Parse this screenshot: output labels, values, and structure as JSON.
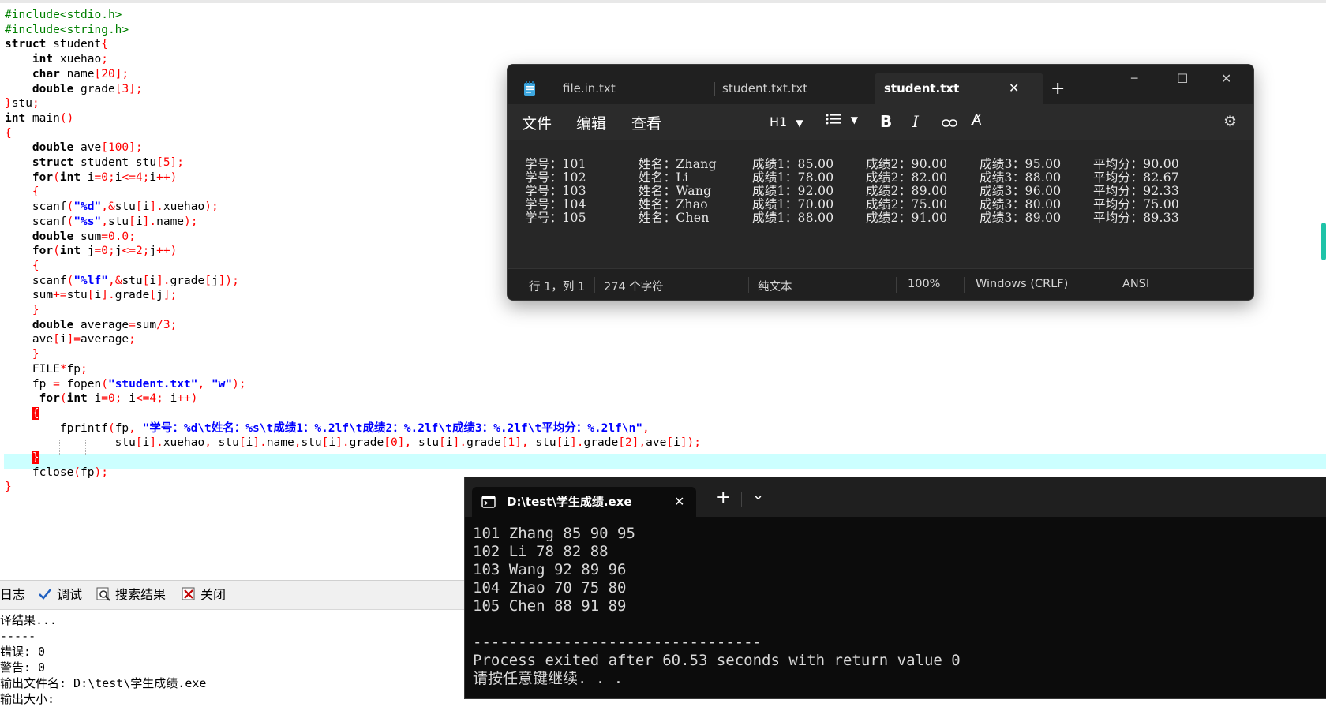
{
  "editor": {
    "code": [
      [
        [
          "pp",
          "#include<stdio.h>"
        ]
      ],
      [
        [
          "pp",
          "#include<string.h>"
        ]
      ],
      [
        [
          "kw",
          "struct"
        ],
        [
          "t",
          " student"
        ],
        [
          "op",
          "{"
        ]
      ],
      [
        [
          "t",
          "    "
        ],
        [
          "kw",
          "int"
        ],
        [
          "t",
          " xuehao"
        ],
        [
          "op",
          ";"
        ]
      ],
      [
        [
          "t",
          "    "
        ],
        [
          "kw",
          "char"
        ],
        [
          "t",
          " name"
        ],
        [
          "op",
          "["
        ],
        [
          "nm",
          "20"
        ],
        [
          "op",
          "];"
        ]
      ],
      [
        [
          "t",
          "    "
        ],
        [
          "kw",
          "double"
        ],
        [
          "t",
          " grade"
        ],
        [
          "op",
          "["
        ],
        [
          "nm",
          "3"
        ],
        [
          "op",
          "];"
        ]
      ],
      [
        [
          "op",
          "}"
        ],
        [
          "t",
          "stu"
        ],
        [
          "op",
          ";"
        ]
      ],
      [
        [
          "kw",
          "int"
        ],
        [
          "t",
          " main"
        ],
        [
          "op",
          "()"
        ]
      ],
      [
        [
          "op",
          "{"
        ]
      ],
      [
        [
          "t",
          "    "
        ],
        [
          "kw",
          "double"
        ],
        [
          "t",
          " ave"
        ],
        [
          "op",
          "["
        ],
        [
          "nm",
          "100"
        ],
        [
          "op",
          "];"
        ]
      ],
      [
        [
          "t",
          "    "
        ],
        [
          "kw",
          "struct"
        ],
        [
          "t",
          " student stu"
        ],
        [
          "op",
          "["
        ],
        [
          "nm",
          "5"
        ],
        [
          "op",
          "];"
        ]
      ],
      [
        [
          "t",
          "    "
        ],
        [
          "kw",
          "for"
        ],
        [
          "op",
          "("
        ],
        [
          "kw",
          "int"
        ],
        [
          "t",
          " i"
        ],
        [
          "op",
          "="
        ],
        [
          "nm",
          "0"
        ],
        [
          "op",
          ";"
        ],
        [
          "t",
          "i"
        ],
        [
          "op",
          "<="
        ],
        [
          "nm",
          "4"
        ],
        [
          "op",
          ";"
        ],
        [
          "t",
          "i"
        ],
        [
          "op",
          "++)"
        ]
      ],
      [
        [
          "t",
          "    "
        ],
        [
          "op",
          "{"
        ]
      ],
      [
        [
          "t",
          "    scanf"
        ],
        [
          "op",
          "("
        ],
        [
          "stb",
          "\"%d\""
        ],
        [
          "op",
          ",&"
        ],
        [
          "t",
          "stu"
        ],
        [
          "op",
          "["
        ],
        [
          "t",
          "i"
        ],
        [
          "op",
          "]."
        ],
        [
          "t",
          "xuehao"
        ],
        [
          "op",
          ");"
        ]
      ],
      [
        [
          "t",
          "    scanf"
        ],
        [
          "op",
          "("
        ],
        [
          "stb",
          "\"%s\""
        ],
        [
          "op",
          ","
        ],
        [
          "t",
          "stu"
        ],
        [
          "op",
          "["
        ],
        [
          "t",
          "i"
        ],
        [
          "op",
          "]."
        ],
        [
          "t",
          "name"
        ],
        [
          "op",
          ");"
        ]
      ],
      [
        [
          "t",
          "    "
        ],
        [
          "kw",
          "double"
        ],
        [
          "t",
          " sum"
        ],
        [
          "op",
          "="
        ],
        [
          "nm",
          "0.0"
        ],
        [
          "op",
          ";"
        ]
      ],
      [
        [
          "t",
          "    "
        ],
        [
          "kw",
          "for"
        ],
        [
          "op",
          "("
        ],
        [
          "kw",
          "int"
        ],
        [
          "t",
          " j"
        ],
        [
          "op",
          "="
        ],
        [
          "nm",
          "0"
        ],
        [
          "op",
          ";"
        ],
        [
          "t",
          "j"
        ],
        [
          "op",
          "<="
        ],
        [
          "nm",
          "2"
        ],
        [
          "op",
          ";"
        ],
        [
          "t",
          "j"
        ],
        [
          "op",
          "++)"
        ]
      ],
      [
        [
          "t",
          "    "
        ],
        [
          "op",
          "{"
        ]
      ],
      [
        [
          "t",
          "    scanf"
        ],
        [
          "op",
          "("
        ],
        [
          "stb",
          "\"%lf\""
        ],
        [
          "op",
          ",&"
        ],
        [
          "t",
          "stu"
        ],
        [
          "op",
          "["
        ],
        [
          "t",
          "i"
        ],
        [
          "op",
          "]."
        ],
        [
          "t",
          "grade"
        ],
        [
          "op",
          "["
        ],
        [
          "t",
          "j"
        ],
        [
          "op",
          "]);"
        ]
      ],
      [
        [
          "t",
          "    sum"
        ],
        [
          "op",
          "+="
        ],
        [
          "t",
          "stu"
        ],
        [
          "op",
          "["
        ],
        [
          "t",
          "i"
        ],
        [
          "op",
          "]."
        ],
        [
          "t",
          "grade"
        ],
        [
          "op",
          "["
        ],
        [
          "t",
          "j"
        ],
        [
          "op",
          "];"
        ]
      ],
      [
        [
          "t",
          "    "
        ],
        [
          "op",
          "}"
        ]
      ],
      [
        [
          "t",
          "    "
        ],
        [
          "kw",
          "double"
        ],
        [
          "t",
          " average"
        ],
        [
          "op",
          "="
        ],
        [
          "t",
          "sum"
        ],
        [
          "op",
          "/"
        ],
        [
          "nm",
          "3"
        ],
        [
          "op",
          ";"
        ]
      ],
      [
        [
          "t",
          "    ave"
        ],
        [
          "op",
          "["
        ],
        [
          "t",
          "i"
        ],
        [
          "op",
          "]="
        ],
        [
          "t",
          "average"
        ],
        [
          "op",
          ";"
        ]
      ],
      [
        [
          "t",
          "    "
        ],
        [
          "op",
          "}"
        ]
      ],
      [
        [
          "t",
          "    FILE"
        ],
        [
          "op",
          "*"
        ],
        [
          "t",
          "fp"
        ],
        [
          "op",
          ";"
        ]
      ],
      [
        [
          "t",
          "    fp "
        ],
        [
          "op",
          "="
        ],
        [
          "t",
          " fopen"
        ],
        [
          "op",
          "("
        ],
        [
          "stb",
          "\"student.txt\""
        ],
        [
          "op",
          ", "
        ],
        [
          "stb",
          "\"w\""
        ],
        [
          "op",
          ");"
        ]
      ],
      [
        [
          "t",
          "     "
        ],
        [
          "kw",
          "for"
        ],
        [
          "op",
          "("
        ],
        [
          "kw",
          "int"
        ],
        [
          "t",
          " i"
        ],
        [
          "op",
          "="
        ],
        [
          "nm",
          "0"
        ],
        [
          "op",
          "; "
        ],
        [
          "t",
          "i"
        ],
        [
          "op",
          "<="
        ],
        [
          "nm",
          "4"
        ],
        [
          "op",
          "; "
        ],
        [
          "t",
          "i"
        ],
        [
          "op",
          "++)"
        ]
      ],
      [
        [
          "t",
          "    "
        ],
        [
          "brk",
          "{"
        ]
      ],
      [
        [
          "t",
          "        fprintf"
        ],
        [
          "op",
          "("
        ],
        [
          "t",
          "fp"
        ],
        [
          "op",
          ", "
        ],
        [
          "stb",
          "\"学号：%d\\t姓名：%s\\t成绩1：%.2lf\\t成绩2：%.2lf\\t成绩3：%.2lf\\t平均分：%.2lf\\n\""
        ],
        [
          "op",
          ","
        ]
      ],
      [
        [
          "t",
          "                stu"
        ],
        [
          "op",
          "["
        ],
        [
          "t",
          "i"
        ],
        [
          "op",
          "]."
        ],
        [
          "t",
          "xuehao"
        ],
        [
          "op",
          ", "
        ],
        [
          "t",
          "stu"
        ],
        [
          "op",
          "["
        ],
        [
          "t",
          "i"
        ],
        [
          "op",
          "]."
        ],
        [
          "t",
          "name"
        ],
        [
          "op",
          ","
        ],
        [
          "t",
          "stu"
        ],
        [
          "op",
          "["
        ],
        [
          "t",
          "i"
        ],
        [
          "op",
          "]."
        ],
        [
          "t",
          "grade"
        ],
        [
          "op",
          "["
        ],
        [
          "nm",
          "0"
        ],
        [
          "op",
          "], "
        ],
        [
          "t",
          "stu"
        ],
        [
          "op",
          "["
        ],
        [
          "t",
          "i"
        ],
        [
          "op",
          "]."
        ],
        [
          "t",
          "grade"
        ],
        [
          "op",
          "["
        ],
        [
          "nm",
          "1"
        ],
        [
          "op",
          "], "
        ],
        [
          "t",
          "stu"
        ],
        [
          "op",
          "["
        ],
        [
          "t",
          "i"
        ],
        [
          "op",
          "]."
        ],
        [
          "t",
          "grade"
        ],
        [
          "op",
          "["
        ],
        [
          "nm",
          "2"
        ],
        [
          "op",
          "],"
        ],
        [
          "t",
          "ave"
        ],
        [
          "op",
          "["
        ],
        [
          "t",
          "i"
        ],
        [
          "op",
          "]);"
        ]
      ],
      [
        [
          "t",
          "    "
        ],
        [
          "brk",
          "}"
        ]
      ],
      [
        [
          "t",
          "    fclose"
        ],
        [
          "op",
          "("
        ],
        [
          "t",
          "fp"
        ],
        [
          "op",
          ");"
        ]
      ],
      [
        [
          "op",
          "}"
        ]
      ]
    ]
  },
  "bottom_panel": {
    "tabs": [
      "日志",
      "调试",
      "搜索结果",
      "关闭"
    ],
    "log_lines": [
      "译结果...",
      "-----",
      "错误: 0",
      "警告: 0",
      "输出文件名: D:\\test\\学生成绩.exe",
      "输出大小: "
    ]
  },
  "notepad": {
    "tabs": [
      "file.in.txt",
      "student.txt.txt",
      "student.txt"
    ],
    "new_tab": "+",
    "window_controls": [
      "─",
      "☐",
      "✕"
    ],
    "menu": [
      "文件",
      "编辑",
      "查看"
    ],
    "heading_label": "H1",
    "toolbar_icons": [
      "list-icon",
      "bold-icon",
      "italic-icon",
      "link-icon",
      "clear-format-icon",
      "settings-icon"
    ],
    "rows": [
      [
        "学号：101",
        "姓名：Zhang",
        "成绩1：85.00",
        "成绩2：90.00",
        "成绩3：95.00",
        "平均分：90.00"
      ],
      [
        "学号：102",
        "姓名：Li",
        "成绩1：78.00",
        "成绩2：82.00",
        "成绩3：88.00",
        "平均分：82.67"
      ],
      [
        "学号：103",
        "姓名：Wang",
        "成绩1：92.00",
        "成绩2：89.00",
        "成绩3：96.00",
        "平均分：92.33"
      ],
      [
        "学号：104",
        "姓名：Zhao",
        "成绩1：70.00",
        "成绩2：75.00",
        "成绩3：80.00",
        "平均分：75.00"
      ],
      [
        "学号：105",
        "姓名：Chen",
        "成绩1：88.00",
        "成绩2：91.00",
        "成绩3：89.00",
        "平均分：89.33"
      ]
    ],
    "status": {
      "position": "行 1，列 1",
      "chars": "274 个字符",
      "format": "纯文本",
      "zoom": "100%",
      "line_ending": "Windows (CRLF)",
      "encoding": "ANSI"
    }
  },
  "terminal": {
    "tab_title": "D:\\test\\学生成绩.exe",
    "new_tab": "+",
    "dropdown": "⌄",
    "lines": [
      "101 Zhang 85 90 95",
      "102 Li 78 82 88",
      "103 Wang 92 89 96",
      "104 Zhao 70 75 80",
      "105 Chen 88 91 89",
      "",
      "--------------------------------",
      "Process exited after 60.53 seconds with return value 0",
      "请按任意键继续. . ."
    ]
  },
  "colors": {
    "keyword": "#000000",
    "preprocessor": "#008000",
    "operator": "#ff0000",
    "string": "#0000ff",
    "current_line": "#ccffff",
    "notepad_bg": "#202020",
    "terminal_bg": "#0c0c0c"
  }
}
